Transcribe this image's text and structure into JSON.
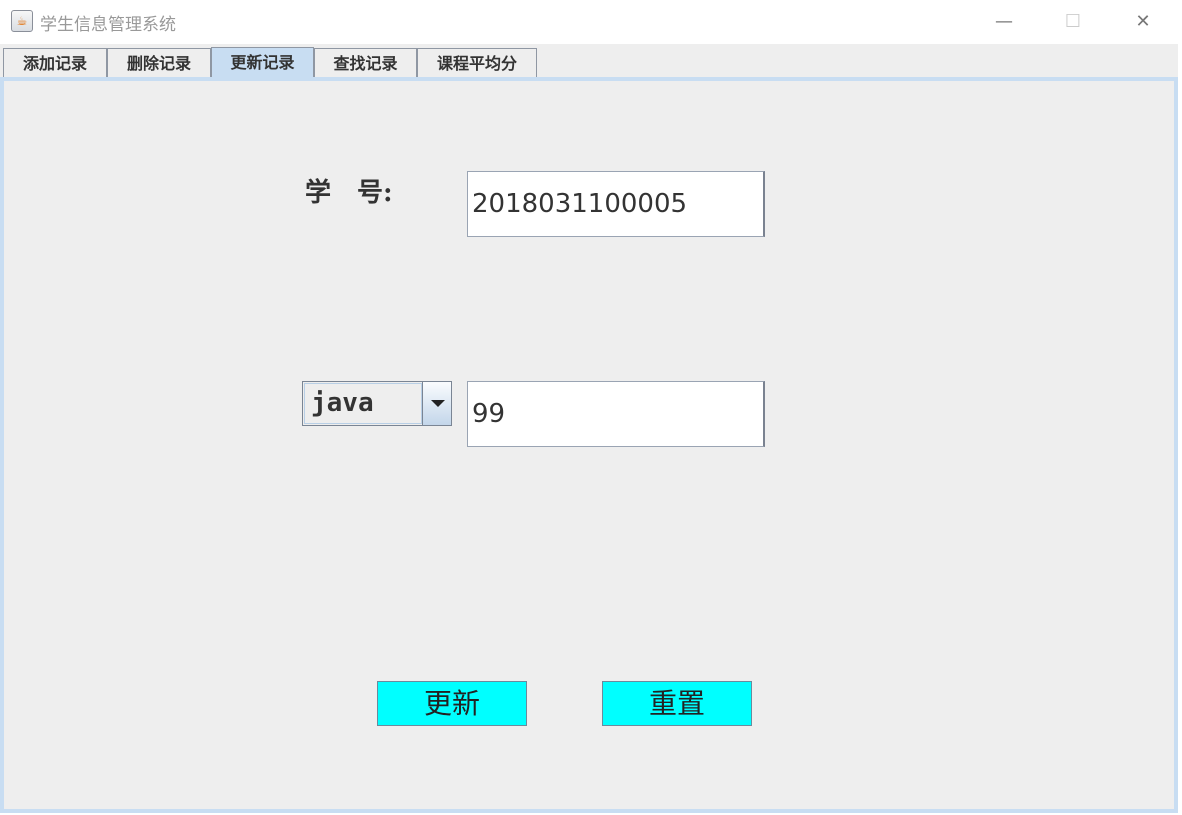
{
  "window": {
    "title": "学生信息管理系统",
    "minimize": "—",
    "maximize": "☐",
    "close": "✕"
  },
  "tabs": [
    {
      "label": "添加记录"
    },
    {
      "label": "删除记录"
    },
    {
      "label": "更新记录",
      "active": true
    },
    {
      "label": "查找记录"
    },
    {
      "label": "课程平均分"
    }
  ],
  "form": {
    "student_id_label": "学　号:",
    "student_id_value": "2018031100005",
    "course_selected": "java",
    "score_value": "99",
    "update_label": "更新",
    "reset_label": "重置"
  },
  "colors": {
    "button": "#00ffff",
    "active_tab": "#c8ddf2"
  }
}
